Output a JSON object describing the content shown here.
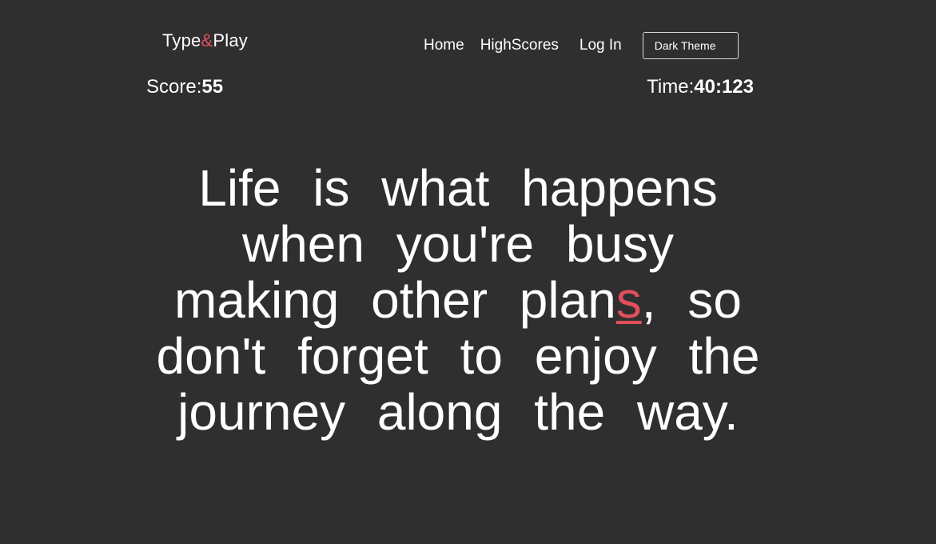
{
  "app": {
    "logo_prefix": "Type",
    "logo_amp": "&",
    "logo_suffix": "Play",
    "accent_color": "#e24e5c",
    "background_color": "#2f2f2f"
  },
  "nav": {
    "home": "Home",
    "highscores": "HighScores",
    "login": "Log In",
    "theme_button": "Dark Theme"
  },
  "stats": {
    "score_label": "Score:",
    "score_value": "55",
    "time_label": "Time:",
    "time_value": "40:123"
  },
  "quote": {
    "typed_before": "Life is what happens when you're busy making other plan",
    "current_char": "s",
    "remaining": ", so don't forget to enjoy the journey along the way."
  }
}
